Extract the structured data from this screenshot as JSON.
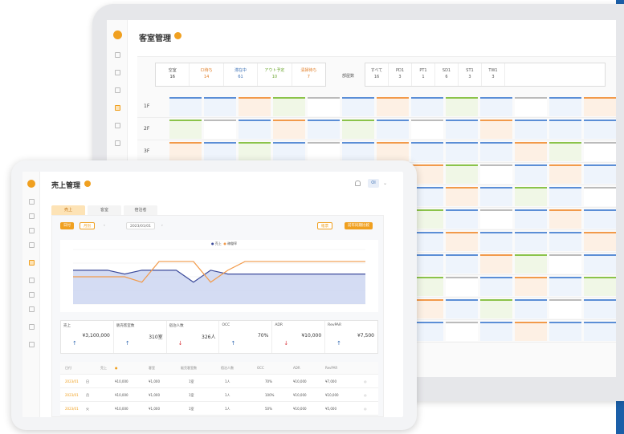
{
  "brand": {
    "accent": "#f0a020",
    "side_bar": "#1b5fa8"
  },
  "laptop": {
    "title": "客室管理",
    "stats": [
      {
        "label": "空室",
        "count": "16",
        "color": "#555"
      },
      {
        "label": "CI待ち",
        "count": "14",
        "color": "#e07b22"
      },
      {
        "label": "滞在中",
        "count": "61",
        "color": "#3a6fb5"
      },
      {
        "label": "アウト予定",
        "count": "10",
        "color": "#6aa52d"
      },
      {
        "label": "清掃待ち",
        "count": "7",
        "color": "#e07b22"
      }
    ],
    "room_type_label": "部屋数",
    "room_types": [
      {
        "label": "すべて",
        "count": "16"
      },
      {
        "label": "PD1",
        "count": "3"
      },
      {
        "label": "PT1",
        "count": "1"
      },
      {
        "label": "SD1",
        "count": "6"
      },
      {
        "label": "ST1",
        "count": "3"
      },
      {
        "label": "TW1",
        "count": "3"
      }
    ],
    "floors": [
      "1F",
      "2F",
      "3F"
    ]
  },
  "tablet": {
    "title": "売上管理",
    "avatar_text": "OI",
    "tabs": [
      "売上",
      "客室",
      "宿泊者"
    ],
    "filters": {
      "period_a": "日付",
      "period_b": "月別",
      "date_range": "2023/01/01",
      "export_label": "帳票",
      "compare_label": "前年同期比較"
    },
    "legend": {
      "a": "売上",
      "b": "稼働率"
    },
    "kpis": [
      {
        "label": "売上",
        "value": "¥3,100,000"
      },
      {
        "label": "販売客室数",
        "value": "310室"
      },
      {
        "label": "宿泊人数",
        "value": "326人"
      },
      {
        "label": "OCC",
        "value": "70%"
      },
      {
        "label": "ADR",
        "value": "¥10,000"
      },
      {
        "label": "RevPAR",
        "value": "¥7,500"
      }
    ],
    "table_header": [
      "日付",
      "",
      "売上",
      "客室",
      "販売客室数",
      "宿泊人数",
      "OCC",
      "ADR",
      "RevPAR",
      ""
    ],
    "table_rows": [
      {
        "date": "2023/01",
        "wd": "日",
        "sales": "¥10,000",
        "rooms": "¥1,000",
        "sold": "1室",
        "guests": "1人",
        "occ": "70%",
        "adr": "¥10,000",
        "rev": "¥7,000"
      },
      {
        "date": "2023/01",
        "wd": "月",
        "sales": "¥10,000",
        "rooms": "¥1,000",
        "sold": "1室",
        "guests": "1人",
        "occ": "100%",
        "adr": "¥10,000",
        "rev": "¥10,000"
      },
      {
        "date": "2023/01",
        "wd": "火",
        "sales": "¥10,000",
        "rooms": "¥1,000",
        "sold": "1室",
        "guests": "1人",
        "occ": "50%",
        "adr": "¥10,000",
        "rev": "¥5,000"
      }
    ]
  }
}
